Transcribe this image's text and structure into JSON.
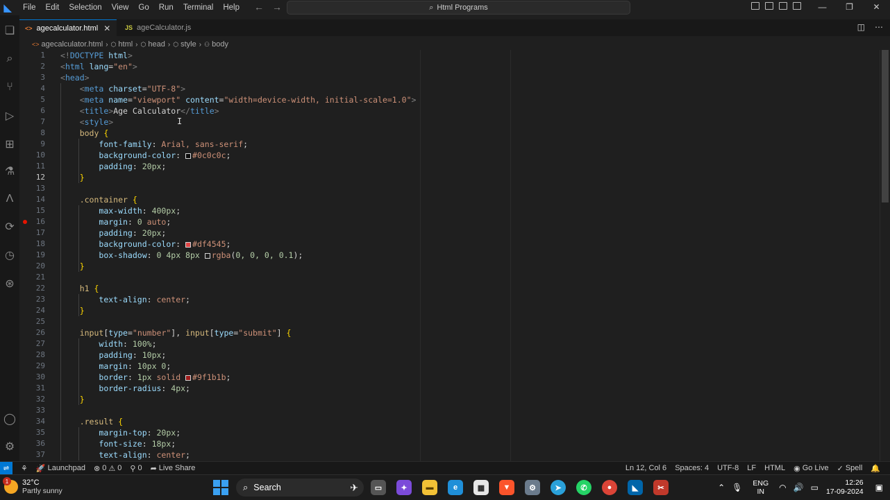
{
  "menu": [
    "File",
    "Edit",
    "Selection",
    "View",
    "Go",
    "Run",
    "Terminal",
    "Help"
  ],
  "command_center": "Html Programs",
  "tabs": [
    {
      "icon": "<>",
      "label": "agecalculator.html",
      "close": "✕"
    },
    {
      "icon": "JS",
      "label": "ageCalculator.js"
    }
  ],
  "breadcrumb": [
    "agecalculator.html",
    "html",
    "head",
    "style",
    "body"
  ],
  "code_lines": [
    {
      "n": "1",
      "t": [
        [
          "t-bracket",
          "<!"
        ],
        [
          "t-tag",
          "DOCTYPE "
        ],
        [
          "t-attr",
          "html"
        ],
        [
          "t-bracket",
          ">"
        ]
      ]
    },
    {
      "n": "2",
      "t": [
        [
          "t-bracket",
          "<"
        ],
        [
          "t-tag",
          "html "
        ],
        [
          "t-attr",
          "lang"
        ],
        [
          "t-punc",
          "="
        ],
        [
          "t-str",
          "\"en\""
        ],
        [
          "t-bracket",
          ">"
        ]
      ]
    },
    {
      "n": "3",
      "t": [
        [
          "t-bracket",
          "<"
        ],
        [
          "t-tag",
          "head"
        ],
        [
          "t-bracket",
          ">"
        ]
      ]
    },
    {
      "n": "4",
      "t": [
        [
          "t-text",
          "    "
        ],
        [
          "t-bracket",
          "<"
        ],
        [
          "t-tag",
          "meta "
        ],
        [
          "t-attr",
          "charset"
        ],
        [
          "t-punc",
          "="
        ],
        [
          "t-str",
          "\"UTF-8\""
        ],
        [
          "t-bracket",
          ">"
        ]
      ]
    },
    {
      "n": "5",
      "t": [
        [
          "t-text",
          "    "
        ],
        [
          "t-bracket",
          "<"
        ],
        [
          "t-tag",
          "meta "
        ],
        [
          "t-attr",
          "name"
        ],
        [
          "t-punc",
          "="
        ],
        [
          "t-str",
          "\"viewport\" "
        ],
        [
          "t-attr",
          "content"
        ],
        [
          "t-punc",
          "="
        ],
        [
          "t-str",
          "\"width=device-width, initial-scale=1.0\""
        ],
        [
          "t-bracket",
          ">"
        ]
      ]
    },
    {
      "n": "6",
      "t": [
        [
          "t-text",
          "    "
        ],
        [
          "t-bracket",
          "<"
        ],
        [
          "t-tag",
          "title"
        ],
        [
          "t-bracket",
          ">"
        ],
        [
          "t-text",
          "Age Calculator"
        ],
        [
          "t-bracket",
          "</"
        ],
        [
          "t-tag",
          "title"
        ],
        [
          "t-bracket",
          ">"
        ]
      ]
    },
    {
      "n": "7",
      "t": [
        [
          "t-text",
          "    "
        ],
        [
          "t-bracket",
          "<"
        ],
        [
          "t-tag",
          "style"
        ],
        [
          "t-bracket",
          ">"
        ]
      ]
    },
    {
      "n": "8",
      "t": [
        [
          "t-text",
          "    "
        ],
        [
          "t-sel",
          "body "
        ],
        [
          "t-brace",
          "{"
        ]
      ]
    },
    {
      "n": "9",
      "t": [
        [
          "t-text",
          "        "
        ],
        [
          "t-prop",
          "font-family"
        ],
        [
          "t-punc",
          ": "
        ],
        [
          "t-val",
          "Arial, sans-serif"
        ],
        [
          "t-punc",
          ";"
        ]
      ]
    },
    {
      "n": "10",
      "t": [
        [
          "t-text",
          "        "
        ],
        [
          "t-prop",
          "background-color"
        ],
        [
          "t-punc",
          ": "
        ],
        [
          "swatch",
          "#0c0c0c"
        ],
        [
          "t-val",
          "#0c0c0c"
        ],
        [
          "t-punc",
          ";"
        ]
      ]
    },
    {
      "n": "11",
      "t": [
        [
          "t-text",
          "        "
        ],
        [
          "t-prop",
          "padding"
        ],
        [
          "t-punc",
          ": "
        ],
        [
          "t-num",
          "20px"
        ],
        [
          "t-punc",
          ";"
        ]
      ]
    },
    {
      "n": "12",
      "t": [
        [
          "t-text",
          "    "
        ],
        [
          "t-brace",
          "}"
        ]
      ]
    },
    {
      "n": "13",
      "t": []
    },
    {
      "n": "14",
      "t": [
        [
          "t-text",
          "    "
        ],
        [
          "t-sel",
          ".container "
        ],
        [
          "t-brace",
          "{"
        ]
      ]
    },
    {
      "n": "15",
      "t": [
        [
          "t-text",
          "        "
        ],
        [
          "t-prop",
          "max-width"
        ],
        [
          "t-punc",
          ": "
        ],
        [
          "t-num",
          "400px"
        ],
        [
          "t-punc",
          ";"
        ]
      ]
    },
    {
      "n": "16",
      "t": [
        [
          "t-text",
          "        "
        ],
        [
          "t-prop",
          "margin"
        ],
        [
          "t-punc",
          ": "
        ],
        [
          "t-num",
          "0 "
        ],
        [
          "t-val",
          "auto"
        ],
        [
          "t-punc",
          ";"
        ]
      ],
      "bp": true
    },
    {
      "n": "17",
      "t": [
        [
          "t-text",
          "        "
        ],
        [
          "t-prop",
          "padding"
        ],
        [
          "t-punc",
          ": "
        ],
        [
          "t-num",
          "20px"
        ],
        [
          "t-punc",
          ";"
        ]
      ]
    },
    {
      "n": "18",
      "t": [
        [
          "t-text",
          "        "
        ],
        [
          "t-prop",
          "background-color"
        ],
        [
          "t-punc",
          ": "
        ],
        [
          "swatch",
          "#df4545"
        ],
        [
          "t-val",
          "#df4545"
        ],
        [
          "t-punc",
          ";"
        ]
      ]
    },
    {
      "n": "19",
      "t": [
        [
          "t-text",
          "        "
        ],
        [
          "t-prop",
          "box-shadow"
        ],
        [
          "t-punc",
          ": "
        ],
        [
          "t-num",
          "0 4px 8px "
        ],
        [
          "swatch",
          "rgba(0,0,0,0.1)"
        ],
        [
          "t-val",
          "rgba"
        ],
        [
          "t-punc",
          "("
        ],
        [
          "t-num",
          "0, 0, 0, 0.1"
        ],
        [
          "t-punc",
          ");"
        ]
      ]
    },
    {
      "n": "20",
      "t": [
        [
          "t-text",
          "    "
        ],
        [
          "t-brace",
          "}"
        ]
      ]
    },
    {
      "n": "21",
      "t": []
    },
    {
      "n": "22",
      "t": [
        [
          "t-text",
          "    "
        ],
        [
          "t-sel",
          "h1 "
        ],
        [
          "t-brace",
          "{"
        ]
      ]
    },
    {
      "n": "23",
      "t": [
        [
          "t-text",
          "        "
        ],
        [
          "t-prop",
          "text-align"
        ],
        [
          "t-punc",
          ": "
        ],
        [
          "t-val",
          "center"
        ],
        [
          "t-punc",
          ";"
        ]
      ]
    },
    {
      "n": "24",
      "t": [
        [
          "t-text",
          "    "
        ],
        [
          "t-brace",
          "}"
        ]
      ]
    },
    {
      "n": "25",
      "t": []
    },
    {
      "n": "26",
      "t": [
        [
          "t-text",
          "    "
        ],
        [
          "t-sel",
          "input"
        ],
        [
          "t-punc",
          "["
        ],
        [
          "t-attr",
          "type"
        ],
        [
          "t-punc",
          "="
        ],
        [
          "t-str",
          "\"number\""
        ],
        [
          "t-punc",
          "], "
        ],
        [
          "t-sel",
          "input"
        ],
        [
          "t-punc",
          "["
        ],
        [
          "t-attr",
          "type"
        ],
        [
          "t-punc",
          "="
        ],
        [
          "t-str",
          "\"submit\""
        ],
        [
          "t-punc",
          "] "
        ],
        [
          "t-brace",
          "{"
        ]
      ]
    },
    {
      "n": "27",
      "t": [
        [
          "t-text",
          "        "
        ],
        [
          "t-prop",
          "width"
        ],
        [
          "t-punc",
          ": "
        ],
        [
          "t-num",
          "100%"
        ],
        [
          "t-punc",
          ";"
        ]
      ]
    },
    {
      "n": "28",
      "t": [
        [
          "t-text",
          "        "
        ],
        [
          "t-prop",
          "padding"
        ],
        [
          "t-punc",
          ": "
        ],
        [
          "t-num",
          "10px"
        ],
        [
          "t-punc",
          ";"
        ]
      ]
    },
    {
      "n": "29",
      "t": [
        [
          "t-text",
          "        "
        ],
        [
          "t-prop",
          "margin"
        ],
        [
          "t-punc",
          ": "
        ],
        [
          "t-num",
          "10px 0"
        ],
        [
          "t-punc",
          ";"
        ]
      ]
    },
    {
      "n": "30",
      "t": [
        [
          "t-text",
          "        "
        ],
        [
          "t-prop",
          "border"
        ],
        [
          "t-punc",
          ": "
        ],
        [
          "t-num",
          "1px "
        ],
        [
          "t-val",
          "solid "
        ],
        [
          "swatch",
          "#9f1b1b"
        ],
        [
          "t-val",
          "#9f1b1b"
        ],
        [
          "t-punc",
          ";"
        ]
      ]
    },
    {
      "n": "31",
      "t": [
        [
          "t-text",
          "        "
        ],
        [
          "t-prop",
          "border-radius"
        ],
        [
          "t-punc",
          ": "
        ],
        [
          "t-num",
          "4px"
        ],
        [
          "t-punc",
          ";"
        ]
      ]
    },
    {
      "n": "32",
      "t": [
        [
          "t-text",
          "    "
        ],
        [
          "t-brace",
          "}"
        ]
      ]
    },
    {
      "n": "33",
      "t": []
    },
    {
      "n": "34",
      "t": [
        [
          "t-text",
          "    "
        ],
        [
          "t-sel",
          ".result "
        ],
        [
          "t-brace",
          "{"
        ]
      ]
    },
    {
      "n": "35",
      "t": [
        [
          "t-text",
          "        "
        ],
        [
          "t-prop",
          "margin-top"
        ],
        [
          "t-punc",
          ": "
        ],
        [
          "t-num",
          "20px"
        ],
        [
          "t-punc",
          ";"
        ]
      ]
    },
    {
      "n": "36",
      "t": [
        [
          "t-text",
          "        "
        ],
        [
          "t-prop",
          "font-size"
        ],
        [
          "t-punc",
          ": "
        ],
        [
          "t-num",
          "18px"
        ],
        [
          "t-punc",
          ";"
        ]
      ]
    },
    {
      "n": "37",
      "t": [
        [
          "t-text",
          "        "
        ],
        [
          "t-prop",
          "text-align"
        ],
        [
          "t-punc",
          ": "
        ],
        [
          "t-val",
          "center"
        ],
        [
          "t-punc",
          ";"
        ]
      ]
    }
  ],
  "current_line": "12",
  "status": {
    "left": [
      "Launchpad",
      "0",
      "0",
      "0",
      "Live Share"
    ],
    "right": [
      "Ln 12, Col 6",
      "Spaces: 4",
      "UTF-8",
      "LF",
      "HTML",
      "Go Live",
      "Spell"
    ]
  },
  "taskbar": {
    "weather_temp": "32°C",
    "weather_desc": "Partly sunny",
    "weather_badge": "1",
    "search": "Search",
    "lang_top": "ENG",
    "lang_bottom": "IN",
    "time": "12:26",
    "date": "17-09-2024"
  },
  "colors": {
    "accent": "#0078d4",
    "breakpoint": "#e51400"
  }
}
